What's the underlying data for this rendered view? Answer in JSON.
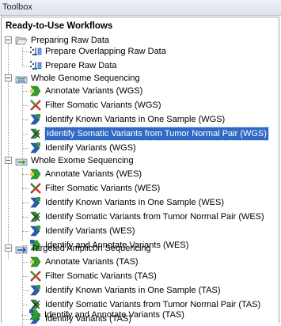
{
  "panel": {
    "title": "Toolbox"
  },
  "tree": {
    "root_title": "Ready-to-Use Workflows",
    "groups": [
      {
        "label": "Preparing Raw Data",
        "icon": "raw-data-folder-icon",
        "items": [
          "Prepare Overlapping Raw Data",
          "Prepare Raw Data"
        ]
      },
      {
        "label": "Whole Genome Sequencing",
        "icon": "wgs-folder-icon",
        "items": [
          "Annotate Variants (WGS)",
          "Filter Somatic Variants (WGS)",
          "Identify Known Variants in One Sample (WGS)",
          "Identify Somatic Variants from Tumor Normal Pair (WGS)",
          "Identify Variants (WGS)"
        ]
      },
      {
        "label": "Whole Exome Sequencing",
        "icon": "wes-folder-icon",
        "items": [
          "Annotate Variants (WES)",
          "Filter Somatic Variants (WES)",
          "Identify Known Variants in One Sample (WES)",
          "Identify Somatic Variants from Tumor Normal Pair (WES)",
          "Identify Variants (WES)",
          "Identify and Annotate Variants (WES)"
        ]
      },
      {
        "label": "Targeted Amplicon Sequencing",
        "icon": "tas-folder-icon",
        "items": [
          "Annotate Variants (TAS)",
          "Filter Somatic Variants (TAS)",
          "Identify Known Variants in One Sample (TAS)",
          "Identify Somatic Variants from Tumor Normal Pair (TAS)",
          "Identify Variants (TAS)",
          "Identify and Annotate Variants (TAS)"
        ]
      }
    ],
    "selected_item": "Identify Somatic Variants from Tumor Normal Pair (WGS)"
  },
  "colors": {
    "selection": "#316ac5",
    "workflow_green": "#2e9e2e",
    "workflow_blue": "#2a5db0"
  }
}
